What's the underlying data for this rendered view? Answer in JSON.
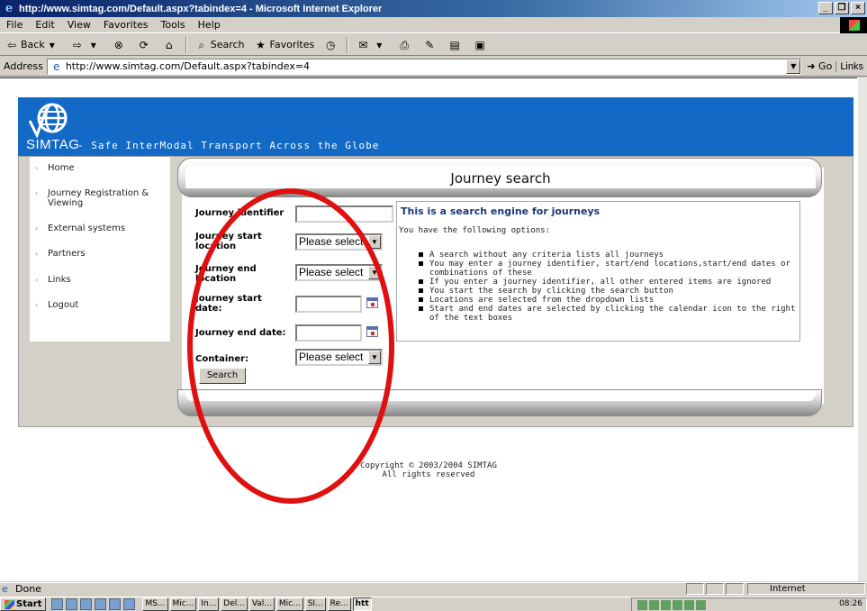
{
  "window": {
    "title": "http://www.simtag.com/Default.aspx?tabindex=4 - Microsoft Internet Explorer",
    "controls": {
      "minimize": "_",
      "maximize": "❐",
      "close": "×"
    }
  },
  "menu": [
    "File",
    "Edit",
    "View",
    "Favorites",
    "Tools",
    "Help"
  ],
  "toolbar": {
    "back": "Back",
    "search": "Search",
    "favorites": "Favorites"
  },
  "address": {
    "label": "Address",
    "url": "http://www.simtag.com/Default.aspx?tabindex=4",
    "go": "Go",
    "links": "Links"
  },
  "site": {
    "logo_text": "SIMTAG",
    "tagline": "- Safe InterModal Transport Across the Globe",
    "brand_color": "#1269c6"
  },
  "nav": [
    {
      "label": "Home"
    },
    {
      "label": "Journey Registration & Viewing"
    },
    {
      "label": "External systems"
    },
    {
      "label": "Partners"
    },
    {
      "label": "Links"
    },
    {
      "label": "Logout"
    }
  ],
  "panel": {
    "title": "Journey search"
  },
  "form": {
    "journey_identifier_label": "Journey identifier",
    "journey_identifier_value": "",
    "start_location_label": "Journey start location",
    "start_location_value": "Please select",
    "end_location_label": "Journey end location",
    "end_location_value": "Please select",
    "start_date_label": "Journey start date:",
    "start_date_value": "",
    "end_date_label": "Journey end date:",
    "end_date_value": "",
    "container_label": "Container:",
    "container_value": "Please select",
    "search_button": "Search"
  },
  "info": {
    "heading": "This is a search engine for journeys",
    "intro": "You have the following options:",
    "items": [
      "A search without any criteria lists all journeys",
      "You may enter a journey identifier, start/end locations,start/end dates or combinations of these",
      "If you enter a journey identifier, all other entered items are ignored",
      "You start the search by clicking the search button",
      "Locations are selected from the dropdown lists",
      "Start and end dates are selected by clicking the calendar icon to the right of the text boxes"
    ]
  },
  "footer": {
    "copyright": "Copyright © 2003/2004  SIMTAG",
    "rights": "All rights reserved"
  },
  "status": {
    "text": "Done",
    "zone": "Internet"
  },
  "taskbar": {
    "start": "Start",
    "tasks": [
      "MS...",
      "Mic...",
      "In...",
      "Del...",
      "Val...",
      "Mic...",
      "SI...",
      "Re...",
      "htt"
    ],
    "clock": "08:26"
  },
  "annotation_color": "#e01010"
}
